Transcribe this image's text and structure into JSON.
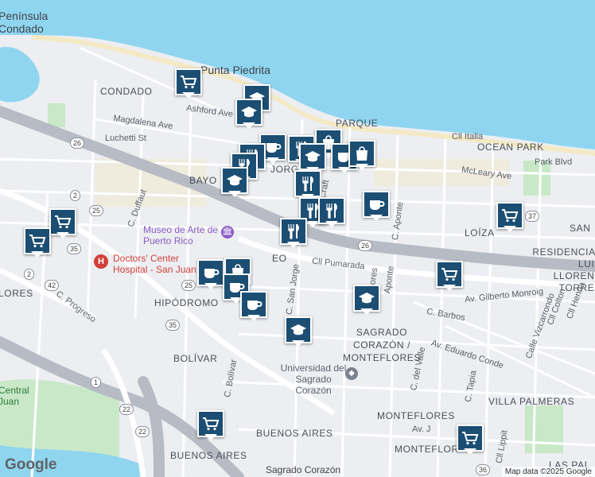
{
  "map": {
    "attribution": "Map data ©2025 Google",
    "logo": "Google"
  },
  "places": {
    "peninsula": "Península",
    "condado_top": "Condado",
    "punta_piedrita": "Punta Piedrita",
    "condado": "CONDADO",
    "ashford": "Ashford Ave",
    "magdalena": "Magdalena Ave",
    "luchetti": "Luchetti St",
    "parque": "PARQUE",
    "cll_italia": "Cll Italia",
    "ocean_park": "OCEAN PARK",
    "park_blvd": "Park Blvd",
    "mcleary": "McLeary Ave",
    "bayo": "BAYO",
    "c_duffaut": "C. Duffaut",
    "museo": "Museo de Arte de Puerto Rico",
    "loiza": "LOÍZA",
    "san": "SAN",
    "residencial": "RESIDENCIAL LUIS LLORENS TORRES",
    "doctors": "Doctors' Center Hospital - San Juan",
    "cll_pumarada": "Cll Pumarada",
    "c_san_jorge": "C. San Jorge",
    "flores": "Flores",
    "aponte": "Aponte",
    "c_aponte": "C. Aponte",
    "eo": "EO",
    "lores": "LORES",
    "c_progreso": "C. Progreso",
    "hipodromo": "HIPÓDROMO",
    "gilberto": "Av. Gilberto Monroig",
    "c_barbos": "C. Barbos",
    "cll_henna": "Cll Henna",
    "cll_colton": "Cll Colton",
    "calle_vizcarrondo": "Calle Vizcarrondo",
    "sagrado": "SAGRADO CORAZÓN / MONTEFLORES",
    "eduardo": "Av. Eduardo Conde",
    "c_del_valle": "C. del Valle",
    "bolivar": "BOLÍVAR",
    "c_bolivar": "C. Bolívar",
    "universidad": "Universidad del Sagrado Corazón",
    "villa_palmeras": "VILLA PALMERAS",
    "central_juan": "Central Juan",
    "monteflores": "MONTEFLORES",
    "av_j": "Av. J",
    "c_tapia": "C. Tapia",
    "buenos_aires_1": "BUENOS AIRES",
    "buenos_aires_2": "BUENOS AIRES",
    "sagrado_station": "Sagrado Corazón",
    "montefl2": "MONTEFLOR",
    "las_pal": "LAS PAL",
    "cll_lippit": "Cll Lippit",
    "crafti": "Craft",
    "jorge": "JORGE"
  },
  "routes": [
    "26",
    "2",
    "25",
    "35",
    "42",
    "2",
    "35",
    "25",
    "37",
    "26",
    "1",
    "22",
    "22",
    "36"
  ],
  "markers": [
    {
      "type": "shopping-cart",
      "label": "grocery"
    },
    {
      "type": "graduation-cap",
      "label": "school"
    },
    {
      "type": "graduation-cap",
      "label": "school"
    },
    {
      "type": "coffee-cup",
      "label": "cafe"
    },
    {
      "type": "fork-knife",
      "label": "restaurant"
    },
    {
      "type": "shopping-bag",
      "label": "store"
    },
    {
      "type": "graduation-cap",
      "label": "school"
    },
    {
      "type": "fork-knife",
      "label": "restaurant"
    },
    {
      "type": "fork-knife",
      "label": "restaurant"
    },
    {
      "type": "coffee-cup",
      "label": "cafe"
    },
    {
      "type": "fork-knife",
      "label": "restaurant"
    },
    {
      "type": "fork-knife",
      "label": "restaurant"
    },
    {
      "type": "fork-knife",
      "label": "restaurant"
    },
    {
      "type": "coffee-cup",
      "label": "cafe"
    },
    {
      "type": "shopping-cart",
      "label": "grocery"
    },
    {
      "type": "shopping-cart",
      "label": "grocery"
    },
    {
      "type": "shopping-cart",
      "label": "grocery"
    },
    {
      "type": "shopping-bag",
      "label": "store"
    },
    {
      "type": "graduation-cap",
      "label": "school"
    },
    {
      "type": "coffee-cup",
      "label": "cafe"
    },
    {
      "type": "shopping-bag",
      "label": "store"
    },
    {
      "type": "coffee-cup",
      "label": "cafe"
    },
    {
      "type": "coffee-cup",
      "label": "cafe"
    },
    {
      "type": "shopping-cart",
      "label": "grocery"
    },
    {
      "type": "graduation-cap",
      "label": "school"
    },
    {
      "type": "graduation-cap",
      "label": "school"
    },
    {
      "type": "shopping-cart",
      "label": "grocery"
    },
    {
      "type": "shopping-cart",
      "label": "grocery"
    },
    {
      "type": "fork-knife",
      "label": "restaurant"
    }
  ],
  "colors": {
    "water": "#8fd5ef",
    "land": "#eceef1",
    "park": "#c8e8c8",
    "marker": "#1c4e73",
    "highway": "#b7bcc4"
  }
}
